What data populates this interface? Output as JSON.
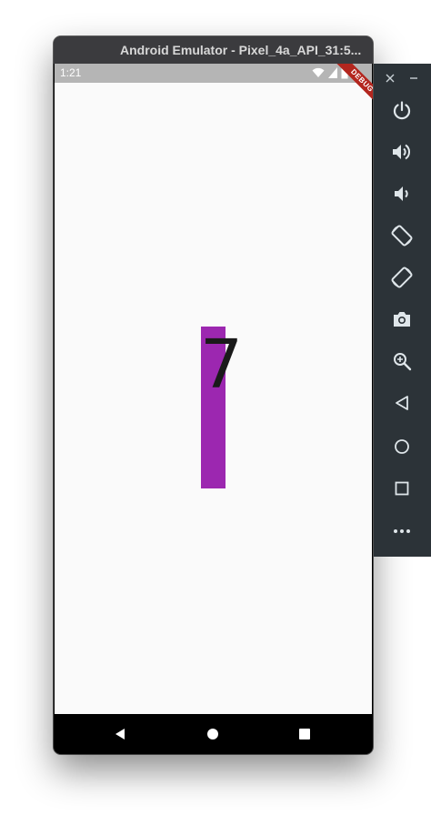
{
  "window": {
    "title": "Android Emulator - Pixel_4a_API_31:5554",
    "title_visible": "Android Emulator - Pixel_4a_API_31:5..."
  },
  "status_bar": {
    "time": "1:21"
  },
  "debug_banner": {
    "label": "DEBUG"
  },
  "app": {
    "counter_value": "7",
    "bar_color": "#9c27b0",
    "background": "#fafafa"
  },
  "nav_bar": {
    "buttons": [
      "back-icon",
      "home-icon",
      "recents-icon"
    ]
  },
  "toolbar": {
    "window_controls": [
      "close-icon",
      "minimize-icon"
    ],
    "buttons": [
      "power-icon",
      "volume-up-icon",
      "volume-down-icon",
      "rotate-left-icon",
      "rotate-right-icon",
      "camera-icon",
      "zoom-icon",
      "back-icon",
      "home-icon",
      "overview-icon",
      "more-icon"
    ]
  }
}
